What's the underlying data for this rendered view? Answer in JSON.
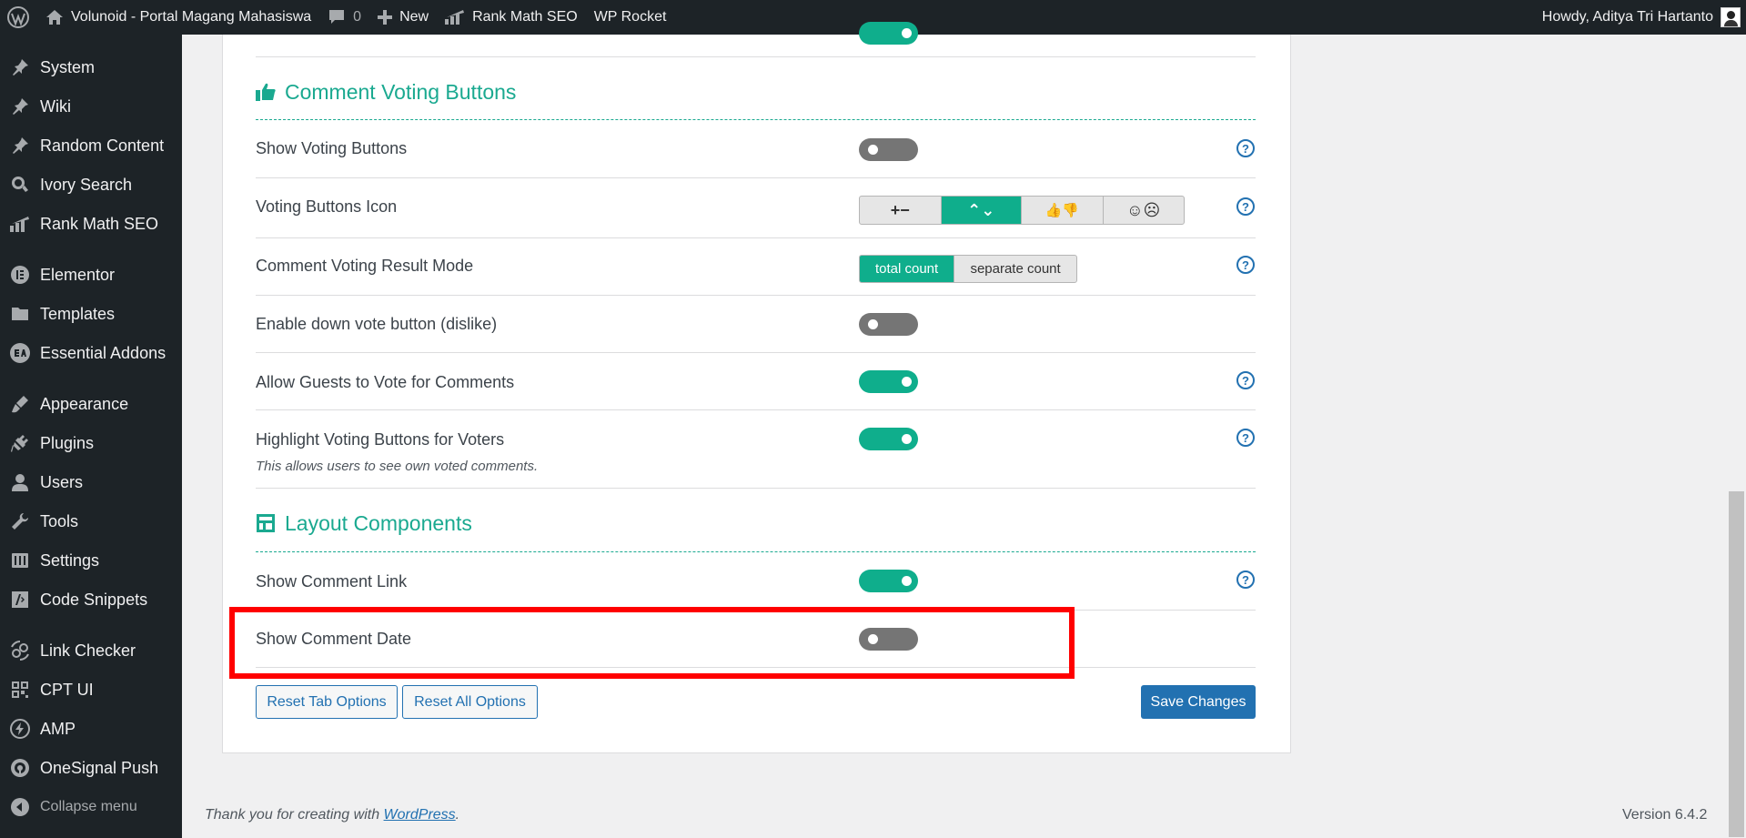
{
  "adminbar": {
    "site_name": "Volunoid - Portal Magang Mahasiswa",
    "comments_count": "0",
    "new_label": "New",
    "rankmath_label": "Rank Math SEO",
    "wprocket_label": "WP Rocket",
    "howdy": "Howdy, Aditya Tri Hartanto"
  },
  "sidebar": {
    "items": [
      {
        "label": "System",
        "icon": "pin-icon"
      },
      {
        "label": "Wiki",
        "icon": "pin-icon"
      },
      {
        "label": "Random Content",
        "icon": "pin-icon"
      },
      {
        "label": "Ivory Search",
        "icon": "search-icon"
      },
      {
        "label": "Rank Math SEO",
        "icon": "chart-icon"
      },
      {
        "label": "Elementor",
        "icon": "elementor-icon"
      },
      {
        "label": "Templates",
        "icon": "folder-icon"
      },
      {
        "label": "Essential Addons",
        "icon": "ea-icon"
      },
      {
        "label": "Appearance",
        "icon": "brush-icon"
      },
      {
        "label": "Plugins",
        "icon": "plugin-icon"
      },
      {
        "label": "Users",
        "icon": "user-icon"
      },
      {
        "label": "Tools",
        "icon": "wrench-icon"
      },
      {
        "label": "Settings",
        "icon": "settings-icon"
      },
      {
        "label": "Code Snippets",
        "icon": "code-icon"
      },
      {
        "label": "Link Checker",
        "icon": "link-icon"
      },
      {
        "label": "CPT UI",
        "icon": "grid-icon"
      },
      {
        "label": "AMP",
        "icon": "bolt-icon"
      },
      {
        "label": "OneSignal Push",
        "icon": "signal-icon"
      }
    ],
    "collapse_label": "Collapse menu"
  },
  "sections": {
    "voting_title": "Comment Voting Buttons",
    "layout_title": "Layout Components"
  },
  "rows": {
    "show_voting": {
      "label": "Show Voting Buttons",
      "enabled": false
    },
    "voting_icon": {
      "label": "Voting Buttons Icon",
      "options": [
        "+−",
        "⌃⌄",
        "👍👎",
        "☺☹"
      ],
      "selected": "⌃⌄"
    },
    "result_mode": {
      "label": "Comment Voting Result Mode",
      "options": [
        "total count",
        "separate count"
      ],
      "selected": "total count"
    },
    "down_vote": {
      "label": "Enable down vote button (dislike)",
      "enabled": false
    },
    "guests_vote": {
      "label": "Allow Guests to Vote for Comments",
      "enabled": true
    },
    "highlight": {
      "label": "Highlight Voting Buttons for Voters",
      "description": "This allows users to see own voted comments.",
      "enabled": true
    },
    "comment_link": {
      "label": "Show Comment Link",
      "enabled": true
    },
    "comment_date": {
      "label": "Show Comment Date",
      "enabled": false
    }
  },
  "buttons": {
    "reset_tab": "Reset Tab Options",
    "reset_all": "Reset All Options",
    "save": "Save Changes"
  },
  "footer": {
    "thanks_prefix": "Thank you for creating with ",
    "wordpress_link": "WordPress",
    "thanks_suffix": ".",
    "version": "Version 6.4.2"
  },
  "colors": {
    "accent": "#1aa990",
    "toggle_on": "#0fae8c",
    "toggle_off": "#757575",
    "primary": "#2271b1",
    "highlight_box": "#ff0000"
  }
}
